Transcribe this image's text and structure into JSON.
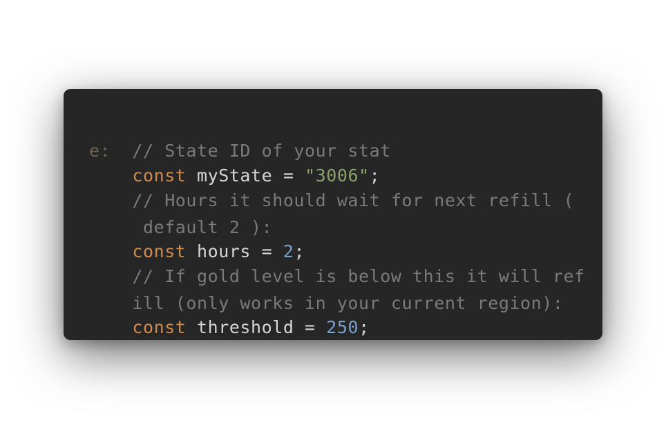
{
  "code": {
    "line1_comment": "// State ID of your stat",
    "line2_overlap": "e:",
    "line2_keyword": "const",
    "line2_name": "myState",
    "line2_eq": " = ",
    "line2_value": "\"3006\"",
    "line2_semi": ";",
    "line3_comment": "// Hours it should wait for next refill (",
    "line4_comment": " default 2 ):",
    "line5_keyword": "const",
    "line5_name": "hours",
    "line5_eq": " = ",
    "line5_value": "2",
    "line5_semi": ";",
    "line6_comment": "// If gold level is below this it will ref",
    "line7_comment": "ill (only works in your current region):",
    "line8_keyword": "const",
    "line8_name": "threshold",
    "line8_eq": " = ",
    "line8_value": "250",
    "line8_semi": ";"
  },
  "colors": {
    "background": "#262626",
    "comment": "#7a7a7a",
    "keyword": "#d08a4c",
    "string": "#8aa36c",
    "number": "#7c9fc8",
    "text": "#d6d6d6"
  }
}
